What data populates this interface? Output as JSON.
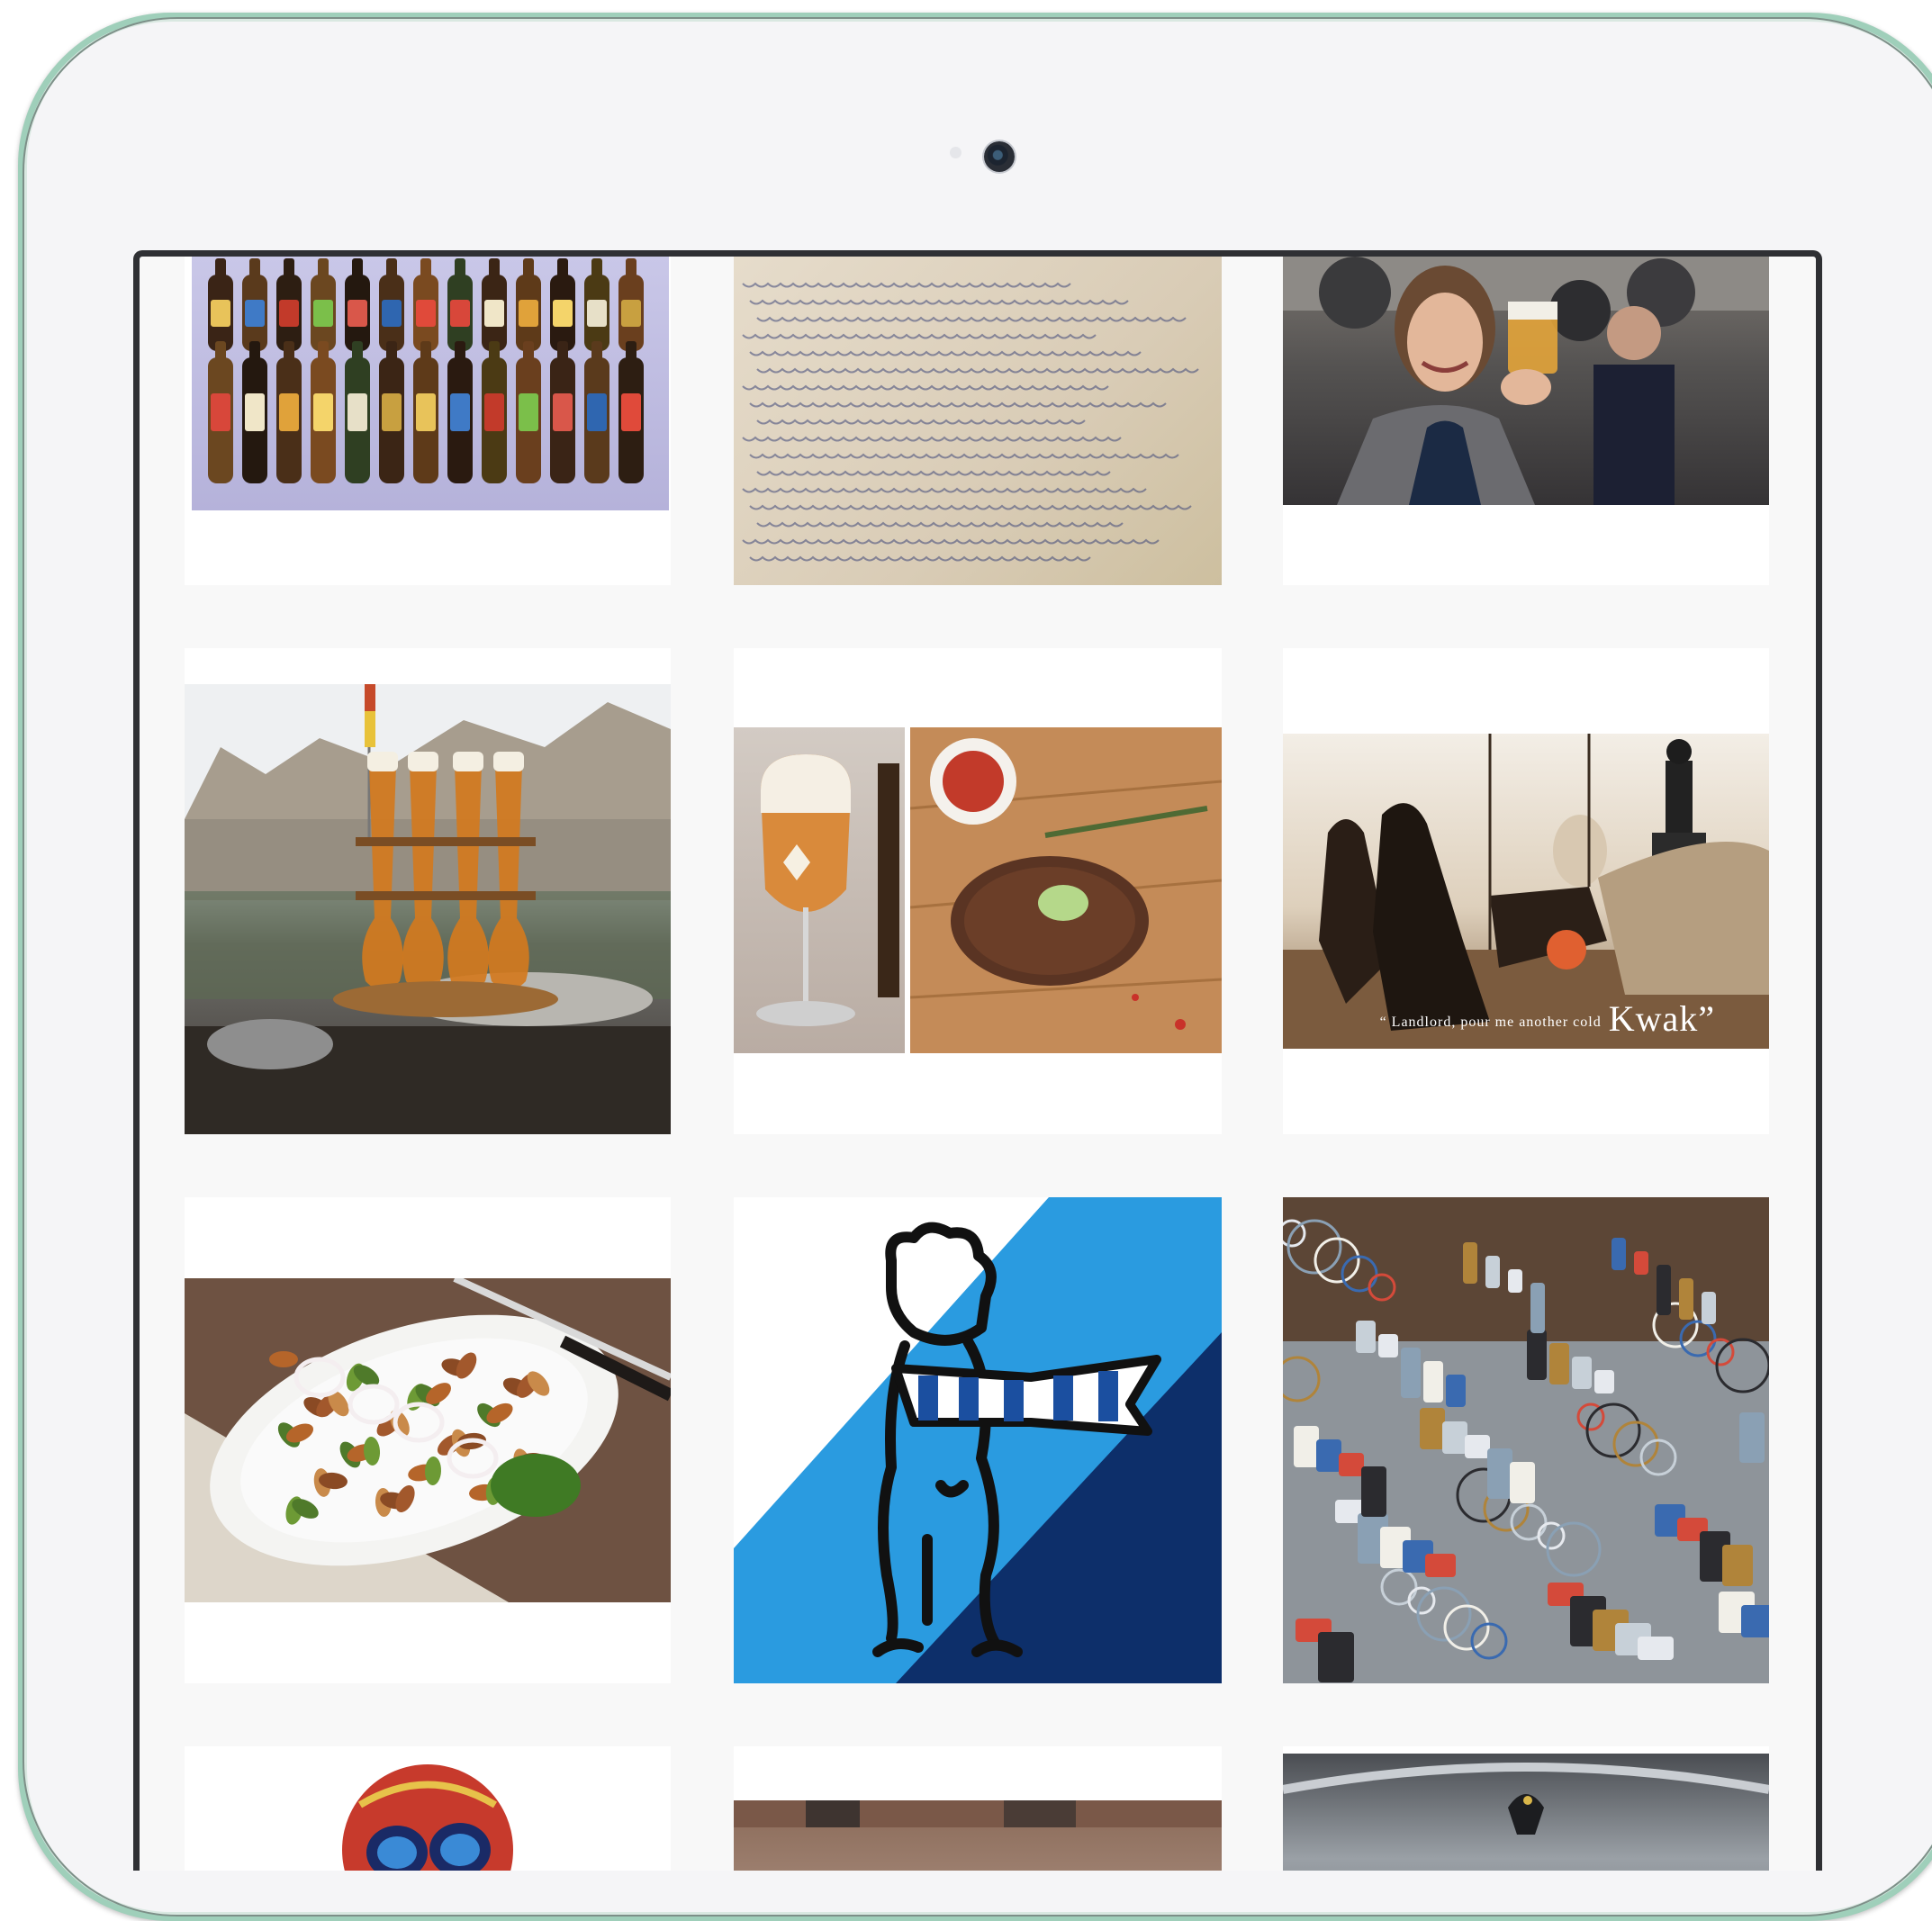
{
  "device": {
    "type": "tablet",
    "frame_color": "#9fcfba",
    "screen_border_color": "#2f3034"
  },
  "gallery": {
    "layout": "3-column image grid",
    "tiles": [
      {
        "name": "belgian-beer-bottles",
        "icon": "photo-icon"
      },
      {
        "name": "handwritten-letter",
        "icon": "photo-icon"
      },
      {
        "name": "woman-holding-beer",
        "icon": "photo-icon"
      },
      {
        "name": "beer-glasses-on-square",
        "icon": "photo-icon"
      },
      {
        "name": "tripel-beer-and-steak",
        "icon": "photo-icon"
      },
      {
        "name": "kwak-horse-carriage",
        "icon": "photo-icon",
        "caption_small": "“ Landlord, pour me another cold",
        "caption_large": "Kwak”"
      },
      {
        "name": "salad-plate",
        "icon": "photo-icon"
      },
      {
        "name": "boy-with-scarf-illustration",
        "icon": "illustration-icon",
        "colors": [
          "#2a9be0",
          "#0d2f6a"
        ]
      },
      {
        "name": "flea-market-glassware",
        "icon": "photo-icon"
      },
      {
        "name": "world-cup-ball-mascot",
        "icon": "photo-icon"
      },
      {
        "name": "city-street",
        "icon": "photo-icon"
      },
      {
        "name": "statue-fountain",
        "icon": "photo-icon"
      }
    ]
  }
}
